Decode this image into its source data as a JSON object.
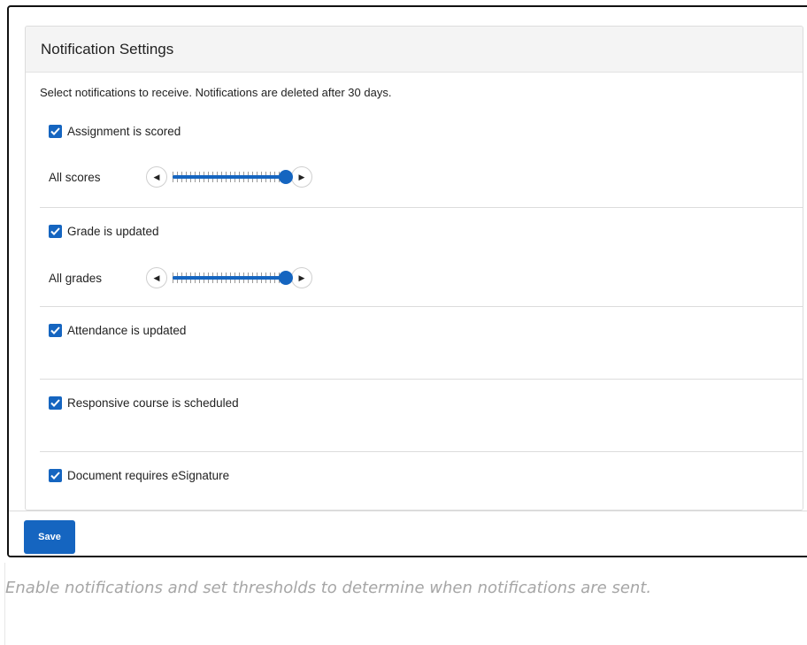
{
  "panel": {
    "title": "Notification Settings",
    "intro": "Select notifications to receive. Notifications are deleted after 30 days."
  },
  "settings": [
    {
      "label": "Assignment is scored",
      "checked": true,
      "slider": {
        "label": "All scores",
        "value_fraction": 1.0
      }
    },
    {
      "label": "Grade is updated",
      "checked": true,
      "slider": {
        "label": "All grades",
        "value_fraction": 1.0
      }
    },
    {
      "label": "Attendance is updated",
      "checked": true
    },
    {
      "label": "Responsive course is scheduled",
      "checked": true
    },
    {
      "label": "Document requires eSignature",
      "checked": true
    }
  ],
  "footer": {
    "save_label": "Save"
  },
  "caption": "Enable notifications and set thresholds to determine when notifications are sent.",
  "colors": {
    "accent": "#1565c0",
    "caption": "#a6a6a6"
  },
  "icons": {
    "checkbox": "checkmark-icon",
    "left_arrow": "caret-left-icon",
    "right_arrow": "caret-right-icon"
  }
}
